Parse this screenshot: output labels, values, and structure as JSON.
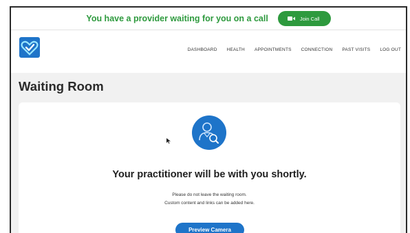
{
  "banner": {
    "message": "You have a provider waiting for you on a call",
    "join_label": "Join Call",
    "color": "#2e9a3e"
  },
  "nav": {
    "logo_icon": "heart-check-icon",
    "links": [
      "DASHBOARD",
      "HEALTH",
      "APPOINTMENTS",
      "CONNECTION",
      "PAST VISITS",
      "LOG OUT"
    ]
  },
  "page": {
    "title": "Waiting Room"
  },
  "card": {
    "icon": "practitioner-search-icon",
    "headline": "Your practitioner will be with you shortly.",
    "info_line1": "Please do not leave the waiting room.",
    "info_line2": "Custom content and links can be added here.",
    "preview_label": "Preview Camera",
    "accent": "#1e74c9"
  }
}
